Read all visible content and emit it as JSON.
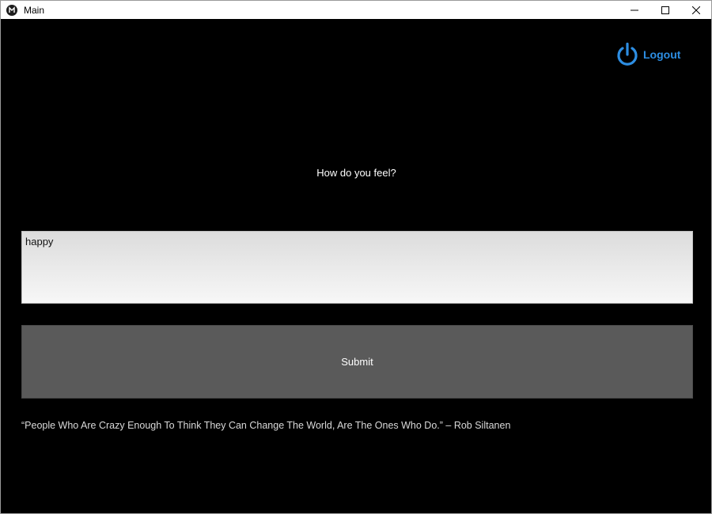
{
  "window": {
    "title": "Main",
    "icons": {
      "app": "kivy-logo-icon",
      "minimize": "minimize-icon",
      "maximize": "maximize-icon",
      "close": "close-icon"
    }
  },
  "header": {
    "logout_label": "Logout",
    "logout_icon": "power-icon",
    "accent_color": "#2d8ee3"
  },
  "main": {
    "question": "How do you feel?",
    "input_value": "happy",
    "submit_label": "Submit",
    "quote": "“People Who Are Crazy Enough To Think They Can Change The World, Are The Ones Who Do.” – Rob Siltanen"
  }
}
